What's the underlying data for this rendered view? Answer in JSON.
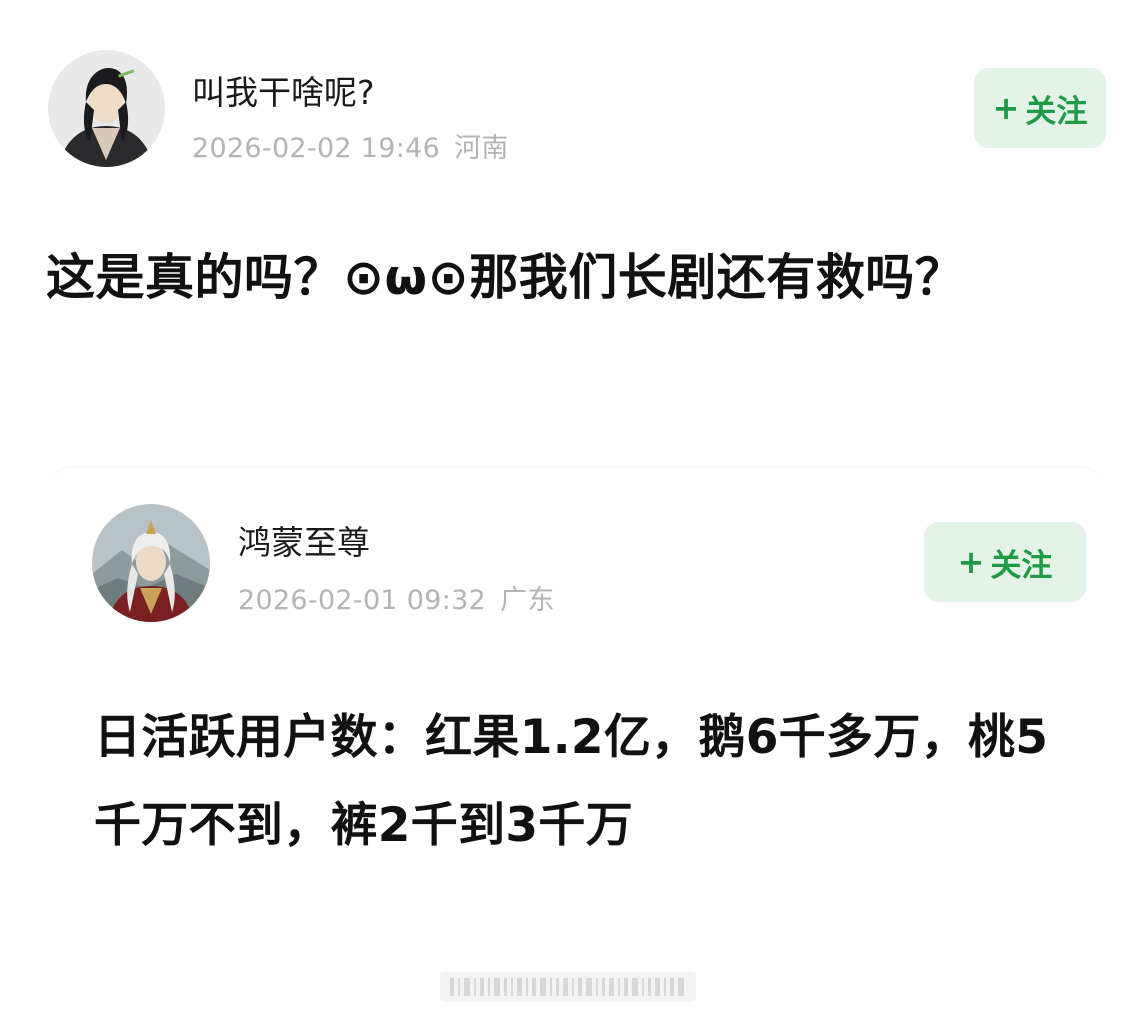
{
  "post": {
    "author": {
      "name": "叫我干啥呢?",
      "timestamp": "2026-02-02 19:46",
      "location": "河南",
      "avatar_icon": "avatar-woman-hanfu-icon"
    },
    "follow_label": "关注",
    "follow_plus": "+",
    "text": "这是真的吗？⊙ω⊙那我们长剧还有救吗？"
  },
  "quoted_post": {
    "author": {
      "name": "鸿蒙至尊",
      "timestamp": "2026-02-01 09:32",
      "location": "广东",
      "avatar_icon": "avatar-xianxia-warrior-icon"
    },
    "follow_label": "关注",
    "follow_plus": "+",
    "text": "日活跃用户数：红果1.2亿，鹅6千多万，桃5千万不到，裤2千到3千万"
  },
  "colors": {
    "follow_bg": "#e4f3e7",
    "follow_text": "#1f9a45",
    "meta_text": "#b4b4b4"
  },
  "watermark_icon": "watermark-barcode-icon"
}
